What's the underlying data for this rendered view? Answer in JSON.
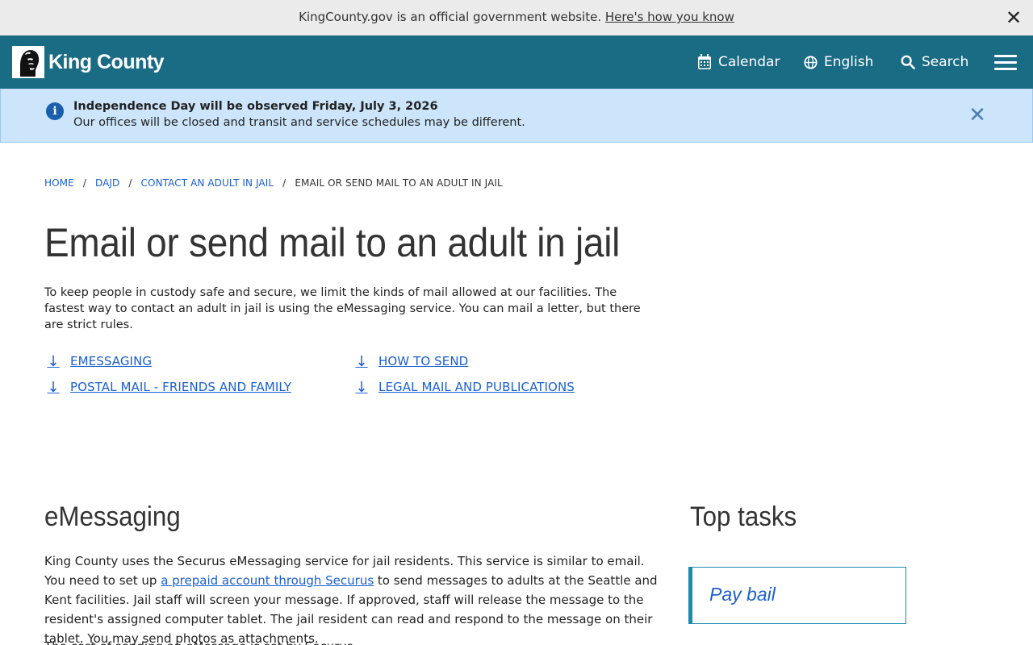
{
  "gov_banner": {
    "text": "KingCounty.gov is an official government website.",
    "link": "Here's how you know",
    "close_glyph": "✕"
  },
  "header": {
    "logo_text": "King County",
    "calendar": "Calendar",
    "language": "English",
    "search": "Search",
    "bg_color": "#1a6b84"
  },
  "alert": {
    "title": "Independence Day will be observed Friday, July 3, 2026",
    "body": "Our offices will be closed and transit and service schedules may be different.",
    "close_glyph": "✕",
    "info_glyph": "i"
  },
  "breadcrumb": {
    "items": [
      "HOME",
      "DAJD",
      "CONTACT AN ADULT IN JAIL"
    ],
    "current": "EMAIL OR SEND MAIL TO AN ADULT IN JAIL",
    "separator": "/"
  },
  "page": {
    "title": "Email or send mail to an adult in jail",
    "intro": "To keep people in custody safe and secure, we limit the kinds of mail allowed at our facilities. The fastest way to contact an adult in jail is using the eMessaging service. You can mail a letter, but there are strict rules."
  },
  "jumplinks": [
    {
      "label": "eMessaging"
    },
    {
      "label": "How to send"
    },
    {
      "label": "Postal mail - friends and family"
    },
    {
      "label": "Legal mail and publications"
    }
  ],
  "section": {
    "heading": "eMessaging",
    "p1_before": "King County uses the Securus eMessaging service for jail residents. This service is similar to email. You need to set up ",
    "p1_link": "a prepaid account through Securus",
    "p1_after": " to send messages to adults at the Seattle and Kent facilities. Jail staff will screen your message. If approved, staff will release the message to the resident's assigned computer tablet. The jail resident can read and respond to the message on their tablet. You may send photos as attachments.",
    "p2": "The cost of sending an eMessage is set by Securus."
  },
  "top_tasks": {
    "heading": "Top tasks",
    "items": [
      "Pay bail"
    ]
  }
}
